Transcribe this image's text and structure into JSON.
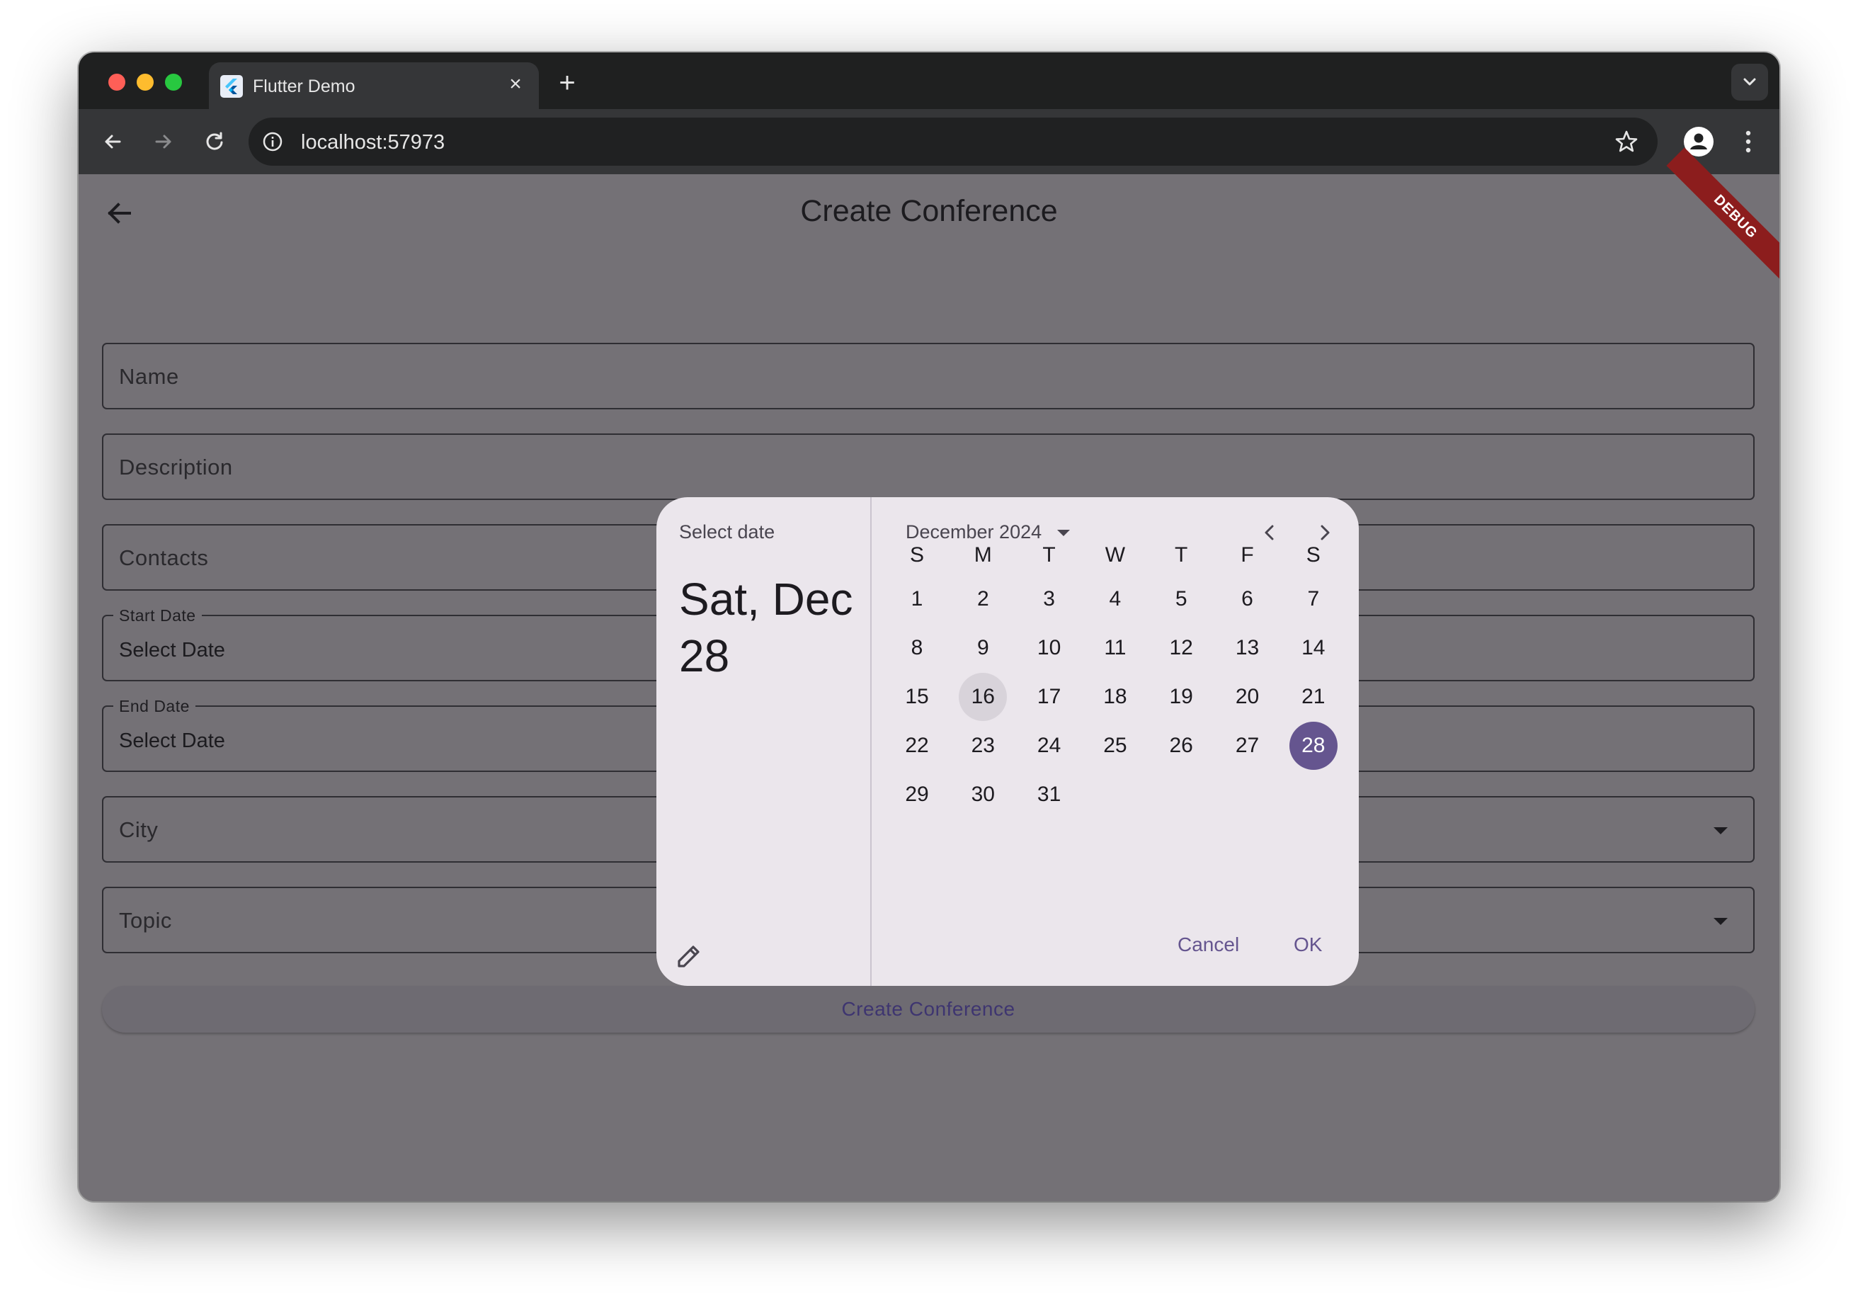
{
  "browser": {
    "tab_title": "Flutter Demo",
    "url": "localhost:57973"
  },
  "app": {
    "title": "Create Conference",
    "debug_banner": "DEBUG",
    "fields": {
      "name": "Name",
      "description": "Description",
      "contacts": "Contacts",
      "start_date_label": "Start Date",
      "start_date_value": "Select Date",
      "end_date_label": "End Date",
      "end_date_value": "Select Date",
      "city": "City",
      "topic": "Topic"
    },
    "submit_label": "Create Conference"
  },
  "date_picker": {
    "help_text": "Select date",
    "headline": "Sat, Dec 28",
    "month_label": "December 2024",
    "weekdays": [
      "S",
      "M",
      "T",
      "W",
      "T",
      "F",
      "S"
    ],
    "first_weekday_index": 0,
    "days_in_month": 31,
    "today": 16,
    "selected": 28,
    "cancel_label": "Cancel",
    "ok_label": "OK"
  },
  "colors": {
    "primary": "#65558f",
    "scrim_background": "#747176",
    "dialog_surface": "#ebe6ec",
    "debug_ribbon": "#8c1d1d"
  },
  "icons": [
    "back-arrow-icon",
    "forward-arrow-icon",
    "reload-icon",
    "info-icon",
    "star-icon",
    "profile-icon",
    "more-vert-icon",
    "edit-pencil-icon",
    "chevron-left-icon",
    "chevron-right-icon",
    "dropdown-arrow-icon"
  ]
}
